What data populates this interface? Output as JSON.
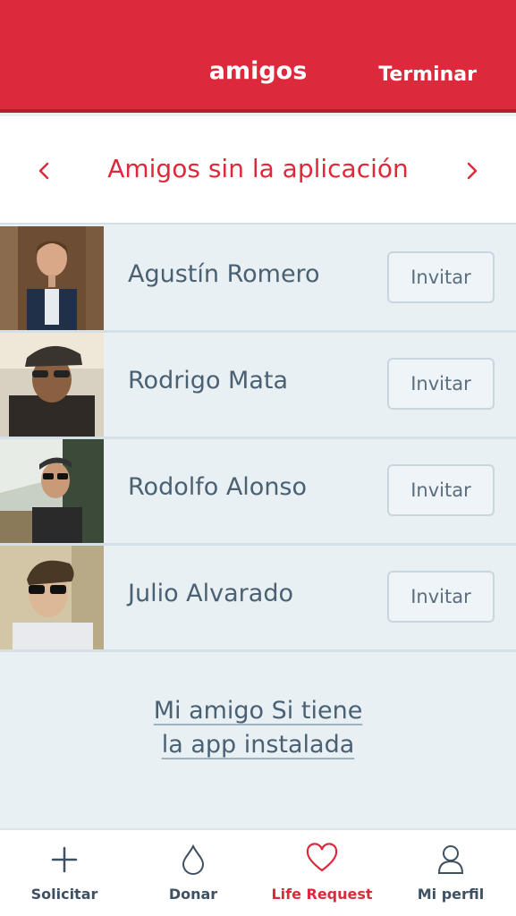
{
  "header": {
    "title": "amigos",
    "done_label": "Terminar"
  },
  "segment": {
    "title": "Amigos sin la aplicación",
    "prev_icon": "chevron-left-icon",
    "next_icon": "chevron-right-icon"
  },
  "friends": [
    {
      "name": "Agustín Romero",
      "invite_label": "Invitar"
    },
    {
      "name": "Rodrigo Mata",
      "invite_label": "Invitar"
    },
    {
      "name": "Rodolfo Alonso",
      "invite_label": "Invitar"
    },
    {
      "name": "Julio Alvarado",
      "invite_label": "Invitar"
    }
  ],
  "installed_link": {
    "line1": "Mi amigo Si tiene",
    "line2": "la app instalada"
  },
  "tabbar": {
    "items": [
      {
        "label": "Solicitar",
        "icon": "plus-icon"
      },
      {
        "label": "Donar",
        "icon": "drop-icon"
      },
      {
        "label": "Life Request",
        "icon": "heart-icon",
        "active": true
      },
      {
        "label": "Mi perfil",
        "icon": "user-icon"
      }
    ]
  },
  "colors": {
    "accent": "#dc2a3c",
    "text": "#4a6073",
    "background": "#e8f0f3"
  }
}
